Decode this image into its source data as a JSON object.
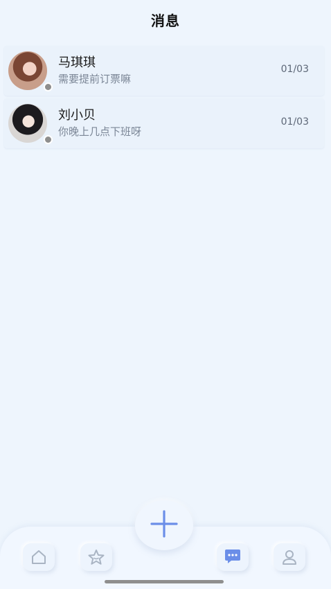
{
  "header": {
    "title": "消息"
  },
  "conversations": [
    {
      "name": "马琪琪",
      "preview": "需要提前订票嘛",
      "time": "01/03",
      "status": "offline"
    },
    {
      "name": "刘小贝",
      "preview": "你晚上几点下班呀",
      "time": "01/03",
      "status": "offline"
    }
  ],
  "bottom_nav": {
    "items": [
      {
        "icon": "home-icon",
        "active": false
      },
      {
        "icon": "star-icon",
        "active": false
      },
      {
        "icon": "message-icon",
        "active": true
      },
      {
        "icon": "user-icon",
        "active": false
      }
    ],
    "fab_icon": "plus-icon"
  },
  "colors": {
    "background": "#eef5fd",
    "accent": "#6b8ee8",
    "icon_inactive": "#a9b4c3",
    "status_offline": "#8e8e8e"
  }
}
